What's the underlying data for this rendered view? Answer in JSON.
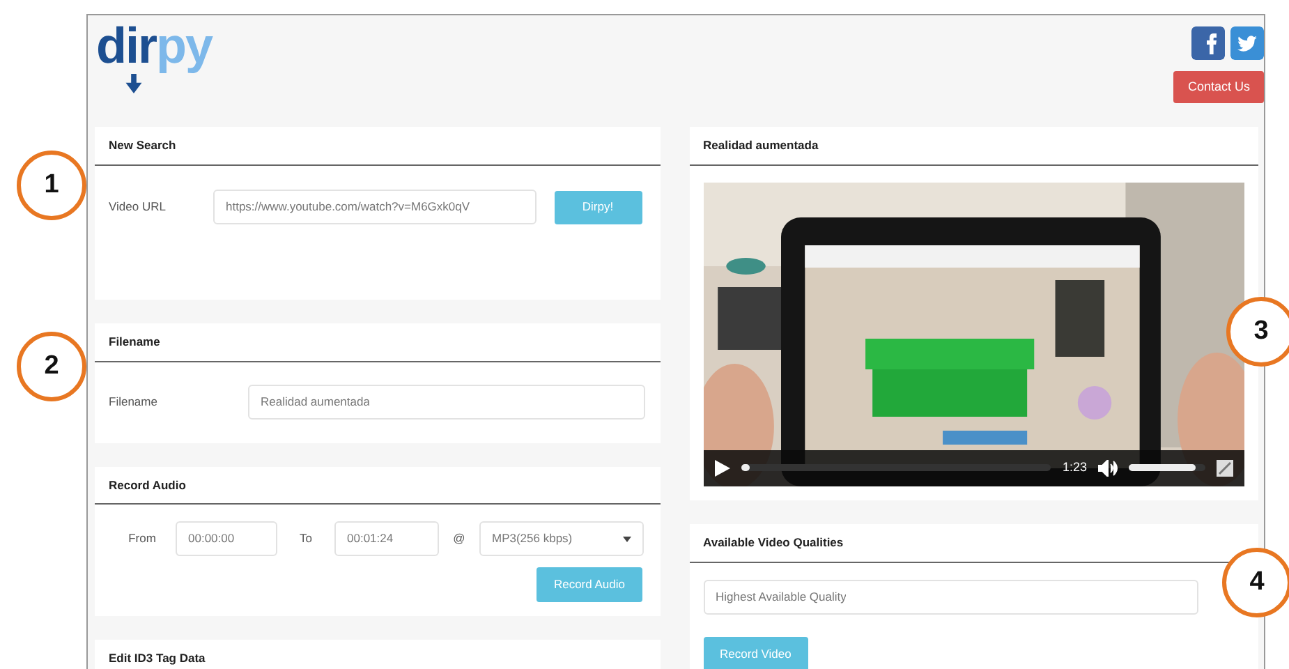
{
  "header": {
    "logo": {
      "dark": "dir",
      "light": "py"
    },
    "contact_button": "Contact Us"
  },
  "left_panels": [
    {
      "kind": "search",
      "title": "New Search",
      "label": "Video URL",
      "value": "https://www.youtube.com/watch?v=M6Gxk0qV",
      "button": "Dirpy!"
    },
    {
      "kind": "filename",
      "title": "Filename",
      "label": "Filename",
      "value": "Realidad aumentada"
    },
    {
      "kind": "audio",
      "title": "Record Audio",
      "from_label": "From",
      "from": "00:00:00",
      "to_label": "To",
      "to": "00:01:24",
      "at_label": "@",
      "format": "MP3(256 kbps)",
      "button": "Record Audio"
    },
    {
      "kind": "header_only",
      "title": "Edit ID3 Tag Data"
    }
  ],
  "video_panel": {
    "title": "Realidad aumentada",
    "player": {
      "kind": "picture",
      "progress": {
        "level": 0.03
      },
      "time": "1:23",
      "volume": {
        "level": 0.88
      }
    }
  },
  "quality_panel": {
    "title": "Available Video Qualities",
    "select": "Highest Available Quality",
    "button": "Record Video"
  },
  "callouts": [
    "1",
    "2",
    "3",
    "4"
  ]
}
